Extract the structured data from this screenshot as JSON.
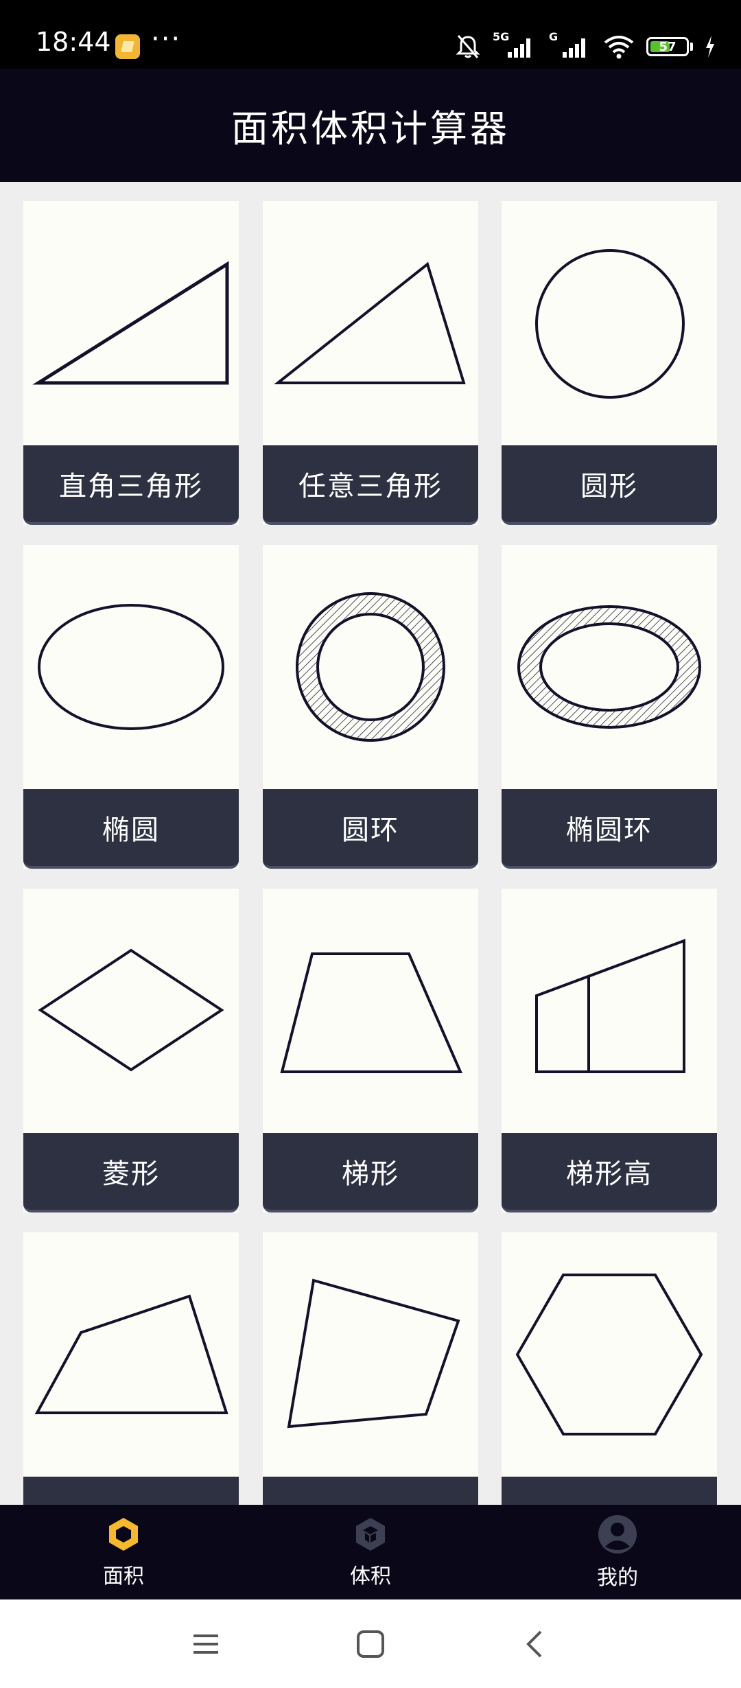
{
  "status_bar": {
    "time": "18:44",
    "more": "···",
    "net1": "5G",
    "net2": "G",
    "battery_level": "57",
    "battery_fraction": 0.57
  },
  "app_bar": {
    "title": "面积体积计算器"
  },
  "shapes": [
    {
      "label": "直角三角形",
      "icon": "right-triangle-shape"
    },
    {
      "label": "任意三角形",
      "icon": "scalene-triangle-shape"
    },
    {
      "label": "圆形",
      "icon": "circle-shape"
    },
    {
      "label": "椭圆",
      "icon": "ellipse-shape"
    },
    {
      "label": "圆环",
      "icon": "ring-shape"
    },
    {
      "label": "椭圆环",
      "icon": "elliptical-ring-shape"
    },
    {
      "label": "菱形",
      "icon": "rhombus-shape"
    },
    {
      "label": "梯形",
      "icon": "trapezoid-shape"
    },
    {
      "label": "梯形高",
      "icon": "trapezoid-height-shape"
    },
    {
      "label": "",
      "icon": "quadrilateral-shape"
    },
    {
      "label": "",
      "icon": "irregular-quadrilateral-shape"
    },
    {
      "label": "",
      "icon": "hexagon-shape"
    }
  ],
  "bottom_nav": [
    {
      "label": "面积",
      "icon": "hexagon-area-icon",
      "active": true,
      "color": "#f5b82e"
    },
    {
      "label": "体积",
      "icon": "cube-volume-icon",
      "active": false,
      "color": "#3c4052"
    },
    {
      "label": "我的",
      "icon": "user-profile-icon",
      "active": false,
      "color": "#3c4052"
    }
  ],
  "system_nav": [
    {
      "icon": "menu-icon"
    },
    {
      "icon": "home-square-icon"
    },
    {
      "icon": "back-chevron-icon"
    }
  ],
  "colors": {
    "app_bar_bg": "#0a0818",
    "label_bg": "#2d3142",
    "card_bg": "#fdfdf7",
    "page_bg": "#eeeeef",
    "active_nav": "#f5b82e"
  }
}
